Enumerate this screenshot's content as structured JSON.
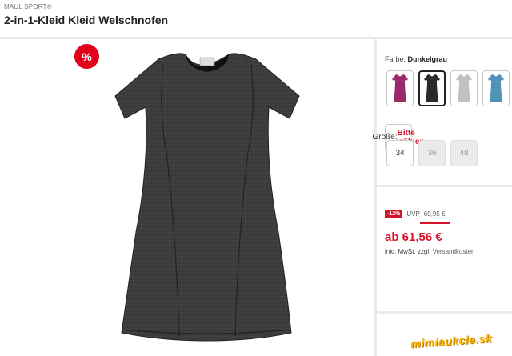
{
  "header": {
    "brand": "MAUL SPORT®",
    "title": "2-in-1-Kleid Kleid Welschnofen"
  },
  "badge": {
    "sale_symbol": "%"
  },
  "color": {
    "label": "Farbe:",
    "selected": "Dunkelgrau",
    "swatches": [
      {
        "name": "berry",
        "color": "#9b2a6b"
      },
      {
        "name": "dark-grey",
        "color": "#2a2a2a",
        "selected": true
      },
      {
        "name": "light-grey",
        "color": "#bfc2c2"
      },
      {
        "name": "blue",
        "color": "#4f94b8"
      }
    ]
  },
  "size": {
    "label": "Größe:",
    "prompt": "Bitte wählen",
    "options": [
      {
        "label": "34",
        "available": true
      },
      {
        "label": "36",
        "available": false
      },
      {
        "label": "48",
        "available": false
      }
    ]
  },
  "pricing": {
    "discount": "-12%",
    "uvp_label": "UVP",
    "uvp_value": "69,95 €",
    "price": "ab 61,56 €",
    "tax_text": "inkl. MwSt. zzgl.",
    "shipping_link": "Versandkosten"
  },
  "watermark": {
    "text": "mimiaukcie.sk"
  },
  "colors": {
    "accent": "#d6132b",
    "badge": "#e3001b"
  }
}
